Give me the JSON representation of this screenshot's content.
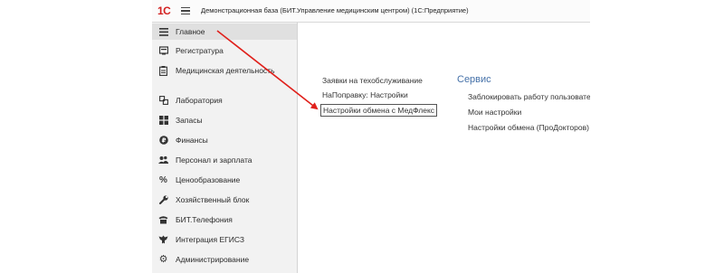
{
  "app": {
    "logo_text": "1С",
    "title": "Демонстрационная база (БИТ.Управление медицинским центром)  (1С:Предприятие)"
  },
  "sidebar": {
    "items": [
      {
        "label": "Главное",
        "icon": "menu-lines-icon"
      },
      {
        "label": "Регистратура",
        "icon": "registry-icon"
      },
      {
        "label": "Медицинская деятельность",
        "icon": "clipboard-icon"
      },
      {
        "label": "Лаборатория",
        "icon": "lab-icon"
      },
      {
        "label": "Запасы",
        "icon": "stock-grid-icon"
      },
      {
        "label": "Финансы",
        "icon": "ruble-coin-icon"
      },
      {
        "label": "Персонал и зарплата",
        "icon": "people-icon"
      },
      {
        "label": "Ценообразование",
        "icon": "percent-icon"
      },
      {
        "label": "Хозяйственный блок",
        "icon": "wrench-icon"
      },
      {
        "label": "БИТ.Телефония",
        "icon": "phone-icon"
      },
      {
        "label": "Интеграция ЕГИСЗ",
        "icon": "emblem-icon"
      },
      {
        "label": "Администрирование",
        "icon": "gear-icon"
      }
    ]
  },
  "main": {
    "links_left": [
      "Заявки на техобслуживание",
      "НаПоправку: Настройки",
      "Настройки обмена с МедФлекс"
    ],
    "service": {
      "title": "Сервис",
      "items": [
        "Заблокировать работу пользователе",
        "Мои настройки",
        "Настройки обмена (ПроДокторов)"
      ]
    }
  },
  "colors": {
    "annotation_arrow": "#e0201b",
    "section_title": "#4470a8",
    "brand": "#d32020"
  }
}
